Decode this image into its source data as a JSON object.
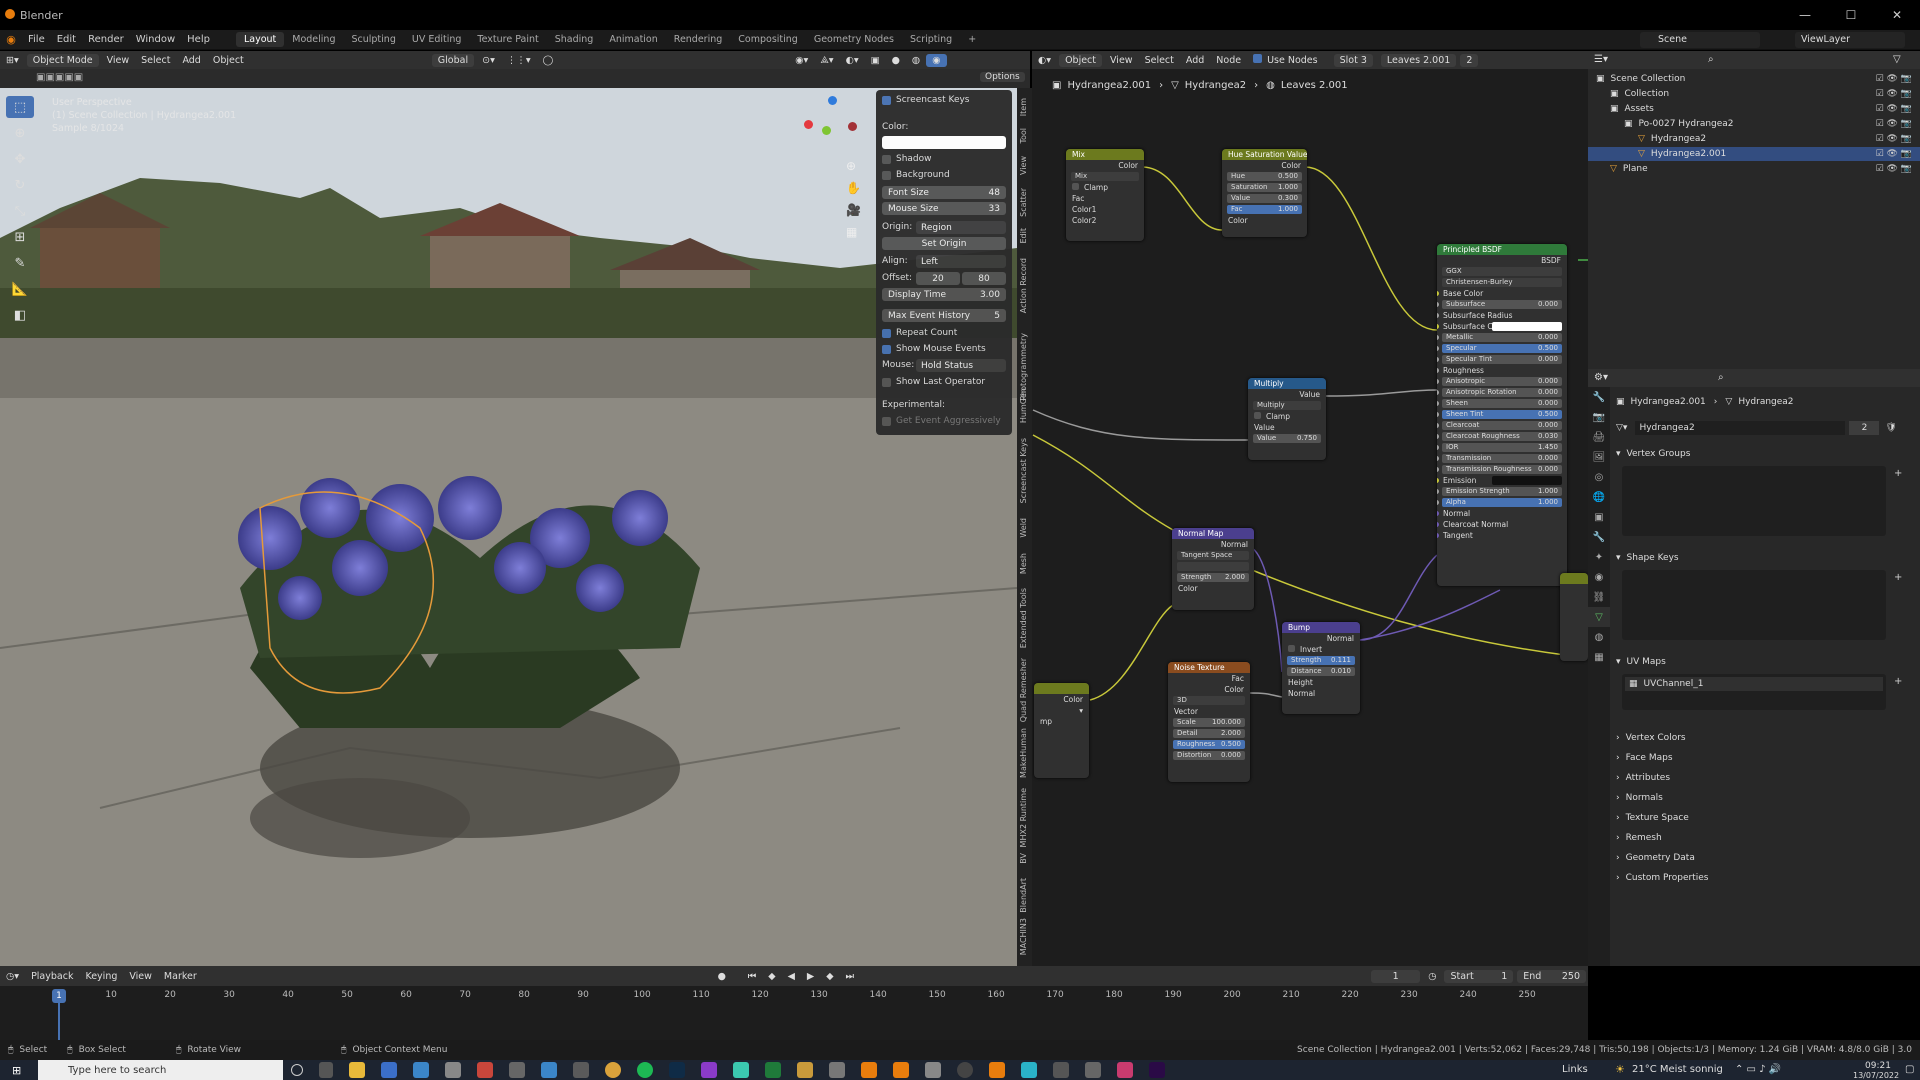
{
  "app": {
    "title": "Blender"
  },
  "menu": [
    "File",
    "Edit",
    "Render",
    "Window",
    "Help"
  ],
  "workspaces": [
    "Layout",
    "Modeling",
    "Sculpting",
    "UV Editing",
    "Texture Paint",
    "Shading",
    "Animation",
    "Rendering",
    "Compositing",
    "Geometry Nodes",
    "Scripting"
  ],
  "top_right": {
    "scene": "Scene",
    "view_layer": "ViewLayer"
  },
  "viewport": {
    "header": {
      "mode": "Object Mode",
      "menu": [
        "View",
        "Select",
        "Add",
        "Object"
      ],
      "orientation": "Global",
      "options": "Options"
    },
    "info": [
      "User Perspective",
      "(1) Scene Collection | Hydrangea2.001",
      "Sample 8/1024"
    ],
    "tools": [
      "select",
      "cursor",
      "move",
      "rotate",
      "scale",
      "transform",
      "annotate",
      "measure",
      "add-cube"
    ]
  },
  "screencast_keys": {
    "title": "Screencast Keys",
    "color_label": "Color:",
    "shadow": "Shadow",
    "background": "Background",
    "font_size_label": "Font Size",
    "font_size": "48",
    "mouse_size_label": "Mouse Size",
    "mouse_size": "33",
    "origin_label": "Origin:",
    "origin": "Region",
    "set_origin": "Set Origin",
    "align_label": "Align:",
    "align": "Left",
    "offset_label": "Offset:",
    "offset_x": "20",
    "offset_y": "80",
    "display_time_label": "Display Time",
    "display_time": "3.00",
    "max_history_label": "Max Event History",
    "max_history": "5",
    "repeat_count": "Repeat Count",
    "show_mouse": "Show Mouse Events",
    "mouse_label": "Mouse:",
    "mouse_mode": "Hold Status",
    "show_last": "Show Last Operator",
    "experimental": "Experimental:",
    "aggressive": "Get Event Aggressively"
  },
  "side_tabs": [
    "Item",
    "Tool",
    "View",
    "Scatter",
    "Edit",
    "Action Record",
    "Photogrammetry",
    "HumGen",
    "Screencast Keys",
    "Weld",
    "Mesh",
    "Extended Tools",
    "Quad Remesher",
    "MakeHuman",
    "MHX2 Runtime",
    "BV",
    "BlendArt",
    "MACHIN3"
  ],
  "node_editor": {
    "header": {
      "object": "Object",
      "menu": [
        "View",
        "Select",
        "Add",
        "Node"
      ],
      "use_nodes": "Use Nodes",
      "slot": "Slot 3",
      "material": "Leaves 2.001",
      "users": "2"
    },
    "breadcrumbs": [
      "Hydrangea2.001",
      "Hydrangea2",
      "Leaves 2.001"
    ],
    "nodes": {
      "mix": {
        "title": "Mix",
        "out": "Color",
        "mode": "Mix",
        "clamp": "Clamp",
        "fac": "Fac",
        "c1": "Color1",
        "c2": "Color2"
      },
      "hsv": {
        "title": "Hue Saturation Value",
        "out": "Color",
        "hue": "Hue",
        "hue_v": "0.500",
        "sat": "Saturation",
        "sat_v": "1.000",
        "val": "Value",
        "val_v": "0.300",
        "fac": "Fac",
        "fac_v": "1.000",
        "color": "Color"
      },
      "multiply": {
        "title": "Multiply",
        "out": "Value",
        "mode": "Multiply",
        "clamp": "Clamp",
        "value": "Value",
        "value2": "Value",
        "value2_v": "0.750"
      },
      "normal_map": {
        "title": "Normal Map",
        "out": "Normal",
        "space": "Tangent Space",
        "strength": "Strength",
        "strength_v": "2.000",
        "color": "Color"
      },
      "bump": {
        "title": "Bump",
        "out": "Normal",
        "invert": "Invert",
        "strength": "Strength",
        "strength_v": "0.111",
        "distance": "Distance",
        "distance_v": "0.010",
        "height": "Height",
        "normal": "Normal"
      },
      "noise": {
        "title": "Noise Texture",
        "fac": "Fac",
        "color": "Color",
        "dim": "3D",
        "vector": "Vector",
        "scale": "Scale",
        "scale_v": "100.000",
        "detail": "Detail",
        "detail_v": "2.000",
        "rough": "Roughness",
        "rough_v": "0.500",
        "distort": "Distortion",
        "distort_v": "0.000"
      },
      "bsdf": {
        "title": "Principled BSDF",
        "out": "BSDF",
        "dist": "GGX",
        "sss": "Christensen-Burley",
        "rows": [
          {
            "l": "Base Color",
            "v": ""
          },
          {
            "l": "Subsurface",
            "v": "0.000"
          },
          {
            "l": "Subsurface Radius",
            "v": ""
          },
          {
            "l": "Subsurface C...",
            "v": ""
          },
          {
            "l": "Metallic",
            "v": "0.000"
          },
          {
            "l": "Specular",
            "v": "0.500"
          },
          {
            "l": "Specular Tint",
            "v": "0.000"
          },
          {
            "l": "Roughness",
            "v": ""
          },
          {
            "l": "Anisotropic",
            "v": "0.000"
          },
          {
            "l": "Anisotropic Rotation",
            "v": "0.000"
          },
          {
            "l": "Sheen",
            "v": "0.000"
          },
          {
            "l": "Sheen Tint",
            "v": "0.500"
          },
          {
            "l": "Clearcoat",
            "v": "0.000"
          },
          {
            "l": "Clearcoat Roughness",
            "v": "0.030"
          },
          {
            "l": "IOR",
            "v": "1.450"
          },
          {
            "l": "Transmission",
            "v": "0.000"
          },
          {
            "l": "Transmission Roughness",
            "v": "0.000"
          },
          {
            "l": "Emission",
            "v": ""
          },
          {
            "l": "Emission Strength",
            "v": "1.000"
          },
          {
            "l": "Alpha",
            "v": "1.000"
          },
          {
            "l": "Normal",
            "v": ""
          },
          {
            "l": "Clearcoat Normal",
            "v": ""
          },
          {
            "l": "Tangent",
            "v": ""
          }
        ]
      },
      "left_partial": {
        "color": "Color",
        "label": "mp"
      }
    }
  },
  "outliner": {
    "rows": [
      {
        "label": "Scene Collection",
        "indent": 0,
        "sel": false
      },
      {
        "label": "Collection",
        "indent": 1,
        "sel": false
      },
      {
        "label": "Assets",
        "indent": 1,
        "sel": false
      },
      {
        "label": "Po-0027 Hydrangea2",
        "indent": 2,
        "sel": false
      },
      {
        "label": "Hydrangea2",
        "indent": 3,
        "sel": false
      },
      {
        "label": "Hydrangea2.001",
        "indent": 3,
        "sel": true
      },
      {
        "label": "Plane",
        "indent": 1,
        "sel": false
      }
    ]
  },
  "properties": {
    "breadcrumbs": [
      "Hydrangea2.001",
      "Hydrangea2"
    ],
    "mesh_name": "Hydrangea2",
    "mesh_users": "2",
    "sections": [
      "Vertex Groups",
      "Shape Keys",
      "UV Maps",
      "Vertex Colors",
      "Face Maps",
      "Attributes",
      "Normals",
      "Texture Space",
      "Remesh",
      "Geometry Data",
      "Custom Properties"
    ],
    "uv_map": "UVChannel_1"
  },
  "timeline": {
    "menu": [
      "Playback",
      "Keying",
      "View",
      "Marker"
    ],
    "current_frame": "1",
    "start_label": "Start",
    "start": "1",
    "end_label": "End",
    "end": "250",
    "ticks": [
      "10",
      "20",
      "30",
      "40",
      "50",
      "60",
      "70",
      "80",
      "90",
      "100",
      "110",
      "120",
      "130",
      "140",
      "150",
      "160",
      "170",
      "180",
      "190",
      "200",
      "210",
      "220",
      "230",
      "240",
      "250"
    ]
  },
  "statusbar": {
    "select": "Select",
    "box_select": "Box Select",
    "rotate": "Rotate View",
    "context": "Object Context Menu",
    "stats": "Scene Collection | Hydrangea2.001 | Verts:52,062 | Faces:29,748 | Tris:50,198 | Objects:1/3 | Memory: 1.24 GiB | VRAM: 4.8/8.0 GiB | 3.0"
  },
  "taskbar": {
    "search": "Type here to search",
    "links": "Links",
    "weather": "21°C  Meist sonnig",
    "time": "09:21",
    "date": "13/07/2022"
  },
  "colors": {
    "accent": "#4772b3",
    "wire_yellow": "#c8c83a",
    "wire_purple": "#6e5ab4",
    "wire_gray": "#9a9a9a"
  }
}
